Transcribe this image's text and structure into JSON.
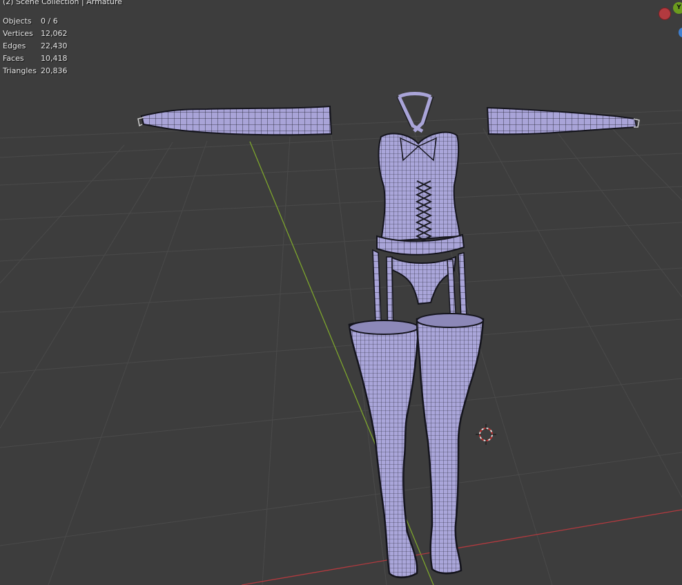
{
  "viewport": {
    "title": "(2) Scene Collection | Armature",
    "background": "#3d3d3d",
    "grid_color": "#4a4a4a",
    "y_axis_color": "#7da52d",
    "x_axis_color": "#b23a3f",
    "mesh_fill": "#a9a4d8",
    "mesh_wire": "#1c1c28"
  },
  "stats": [
    {
      "label": "Objects",
      "value": "0 / 6"
    },
    {
      "label": "Vertices",
      "value": "12,062"
    },
    {
      "label": "Edges",
      "value": "22,430"
    },
    {
      "label": "Faces",
      "value": "10,418"
    },
    {
      "label": "Triangles",
      "value": "20,836"
    }
  ],
  "gizmo": {
    "x_label": "",
    "y_label": "Y",
    "z_label": ""
  },
  "icons": {
    "cursor": "3d-cursor-icon",
    "gizmo": "navigation-gizmo-icon"
  }
}
